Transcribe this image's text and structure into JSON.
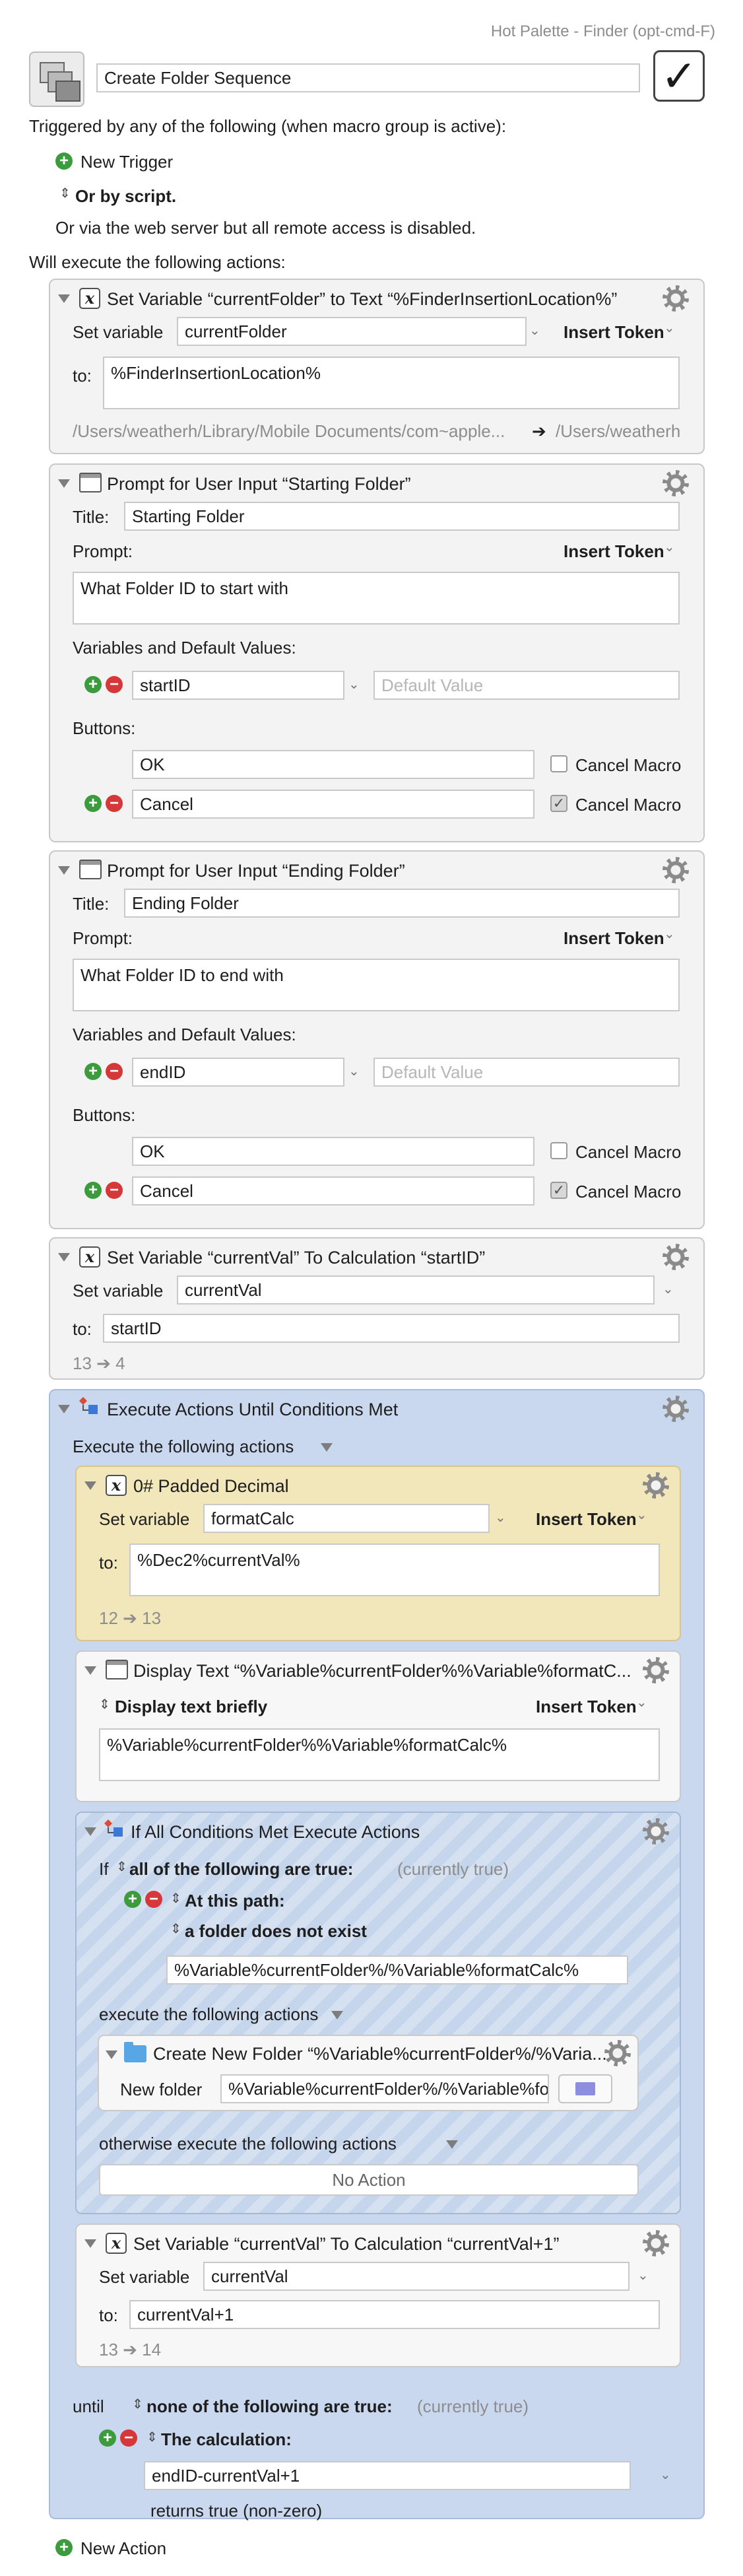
{
  "window": {
    "title": "Hot Palette - Finder (opt-cmd-F)"
  },
  "macro": {
    "name": "Create Folder Sequence",
    "enabled_check": "✓",
    "triggered_text": "Triggered by any of the following (when macro group is active):",
    "new_trigger_label": "New Trigger",
    "by_script_label": "Or by script.",
    "web_server_text": "Or via the web server but all remote access is disabled.",
    "will_execute_text": "Will execute the following actions:",
    "new_action_label": "New Action"
  },
  "actions": {
    "set_folder": {
      "title": "Set Variable “currentFolder” to Text “%FinderInsertionLocation%”",
      "set_variable_label": "Set variable",
      "variable": "currentFolder",
      "insert_token": "Insert Token",
      "to_label": "to:",
      "value": "%FinderInsertionLocation%",
      "preview_left": "/Users/weatherh/Library/Mobile Documents/com~apple...",
      "preview_arrow": "➔",
      "preview_right": "/Users/weatherh"
    },
    "prompt_start": {
      "title": "Prompt for User Input “Starting Folder”",
      "title_label": "Title:",
      "title_value": "Starting Folder",
      "prompt_label": "Prompt:",
      "insert_token": "Insert Token",
      "prompt_value": "What Folder ID to start with",
      "vars_label": "Variables and Default Values:",
      "var_name": "startID",
      "default_placeholder": "Default Value",
      "buttons_label": "Buttons:",
      "button1": "OK",
      "button2": "Cancel",
      "cancel_macro": "Cancel Macro",
      "check": "✓"
    },
    "prompt_end": {
      "title": "Prompt for User Input “Ending Folder”",
      "title_label": "Title:",
      "title_value": "Ending Folder",
      "prompt_label": "Prompt:",
      "insert_token": "Insert Token",
      "prompt_value": "What Folder ID to end with",
      "vars_label": "Variables and Default Values:",
      "var_name": "endID",
      "default_placeholder": "Default Value",
      "buttons_label": "Buttons:",
      "button1": "OK",
      "button2": "Cancel",
      "cancel_macro": "Cancel Macro",
      "check": "✓"
    },
    "set_val": {
      "title": "Set Variable “currentVal” To Calculation “startID”",
      "set_variable_label": "Set variable",
      "variable": "currentVal",
      "to_label": "to:",
      "value": "startID",
      "result": "13 ➔ 4"
    },
    "until_loop": {
      "title": "Execute Actions Until Conditions Met",
      "execute_label": "Execute the following actions",
      "padded": {
        "title": "0# Padded Decimal",
        "set_variable_label": "Set variable",
        "variable": "formatCalc",
        "insert_token": "Insert Token",
        "to_label": "to:",
        "value": "%Dec2%currentVal%",
        "result": "12 ➔ 13"
      },
      "display": {
        "title": "Display Text “%Variable%currentFolder%%Variable%formatC...",
        "mode": "Display text briefly",
        "insert_token": "Insert Token",
        "value": "%Variable%currentFolder%%Variable%formatCalc%"
      },
      "if_block": {
        "title": "If All Conditions Met Execute Actions",
        "if_label": "If",
        "all_label": "all of the following are true:",
        "status": "(currently true)",
        "path_label": "At this path:",
        "condition": "a folder does not exist",
        "path_value": "%Variable%currentFolder%/%Variable%formatCalc%",
        "execute_label": "execute the following actions",
        "new_folder": {
          "title": "Create New Folder “%Variable%currentFolder%/%Varia...",
          "label": "New folder",
          "value": "%Variable%currentFolder%/%Variable%fo"
        },
        "otherwise_label": "otherwise execute the following actions",
        "no_action": "No Action"
      },
      "increment": {
        "title": "Set Variable “currentVal” To Calculation “currentVal+1”",
        "set_variable_label": "Set variable",
        "variable": "currentVal",
        "to_label": "to:",
        "value": "currentVal+1",
        "result": "13 ➔ 14"
      },
      "until_label": "until",
      "none_label": "none of the following are true:",
      "until_status": "(currently true)",
      "calc_label": "The calculation:",
      "calc_value": "endID-currentVal+1",
      "returns": "returns true (non-zero)"
    }
  }
}
